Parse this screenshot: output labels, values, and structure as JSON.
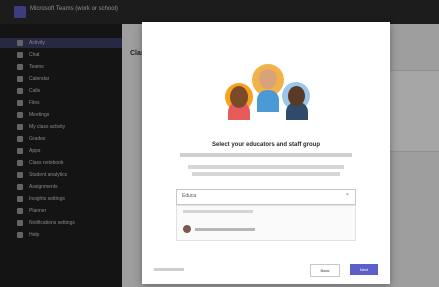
{
  "window": {
    "title": "Microsoft Teams (work or school)"
  },
  "sidebar": {
    "items": [
      {
        "label": "Activity",
        "active": true
      },
      {
        "label": "Chat"
      },
      {
        "label": "Teams"
      },
      {
        "label": "Calendar"
      },
      {
        "label": "Calls"
      },
      {
        "label": "Files"
      },
      {
        "label": "Meetings"
      },
      {
        "label": "My class activity"
      },
      {
        "label": "Grades"
      },
      {
        "label": "Apps"
      },
      {
        "label": "Class notebook"
      },
      {
        "label": "Student analytics"
      },
      {
        "label": "Assignments"
      },
      {
        "label": "Insights settings"
      },
      {
        "label": "Planner"
      },
      {
        "label": "Notifications settings"
      },
      {
        "label": "Help"
      }
    ]
  },
  "main": {
    "heading": "Class"
  },
  "dialog": {
    "title": "Select your educators and staff group",
    "search_value": "Educa",
    "buttons": {
      "back": "Back",
      "next": "Next"
    }
  }
}
